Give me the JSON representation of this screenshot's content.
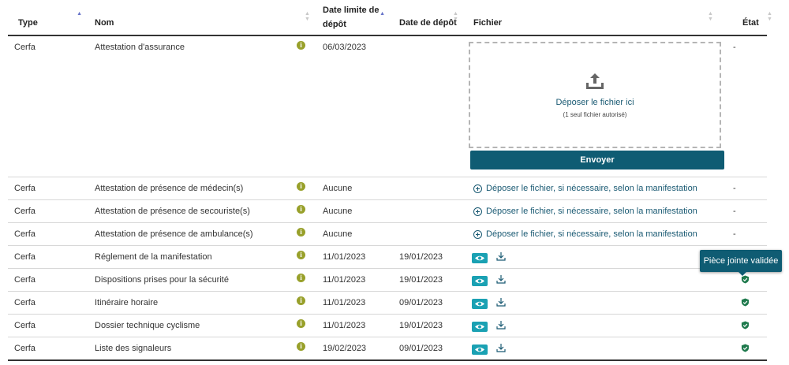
{
  "headers": {
    "type": "Type",
    "nom": "Nom",
    "date_limite": "Date limite de dépôt",
    "date_depot": "Date de dépôt",
    "fichier": "Fichier",
    "etat": "État"
  },
  "dropzone": {
    "title": "Déposer le fichier ici",
    "subtitle": "(1 seul fichier autorisé)",
    "send_label": "Envoyer"
  },
  "upload_link_label": "Déposer le fichier, si nécessaire, selon la manifestation",
  "tooltip": "Pièce jointe validée",
  "rows": [
    {
      "type": "Cerfa",
      "nom": "Attestation d'assurance",
      "date_limite": "06/03/2023",
      "date_depot": "",
      "etat": "-"
    },
    {
      "type": "Cerfa",
      "nom": "Attestation de présence de médecin(s)",
      "date_limite": "Aucune",
      "date_depot": "",
      "etat": "-"
    },
    {
      "type": "Cerfa",
      "nom": "Attestation de présence de secouriste(s)",
      "date_limite": "Aucune",
      "date_depot": "",
      "etat": "-"
    },
    {
      "type": "Cerfa",
      "nom": "Attestation de présence de ambulance(s)",
      "date_limite": "Aucune",
      "date_depot": "",
      "etat": "-"
    },
    {
      "type": "Cerfa",
      "nom": "Réglement de la manifestation",
      "date_limite": "11/01/2023",
      "date_depot": "19/01/2023",
      "etat": ""
    },
    {
      "type": "Cerfa",
      "nom": "Dispositions prises pour la sécurité",
      "date_limite": "11/01/2023",
      "date_depot": "19/01/2023",
      "etat": ""
    },
    {
      "type": "Cerfa",
      "nom": "Itinéraire horaire",
      "date_limite": "11/01/2023",
      "date_depot": "09/01/2023",
      "etat": ""
    },
    {
      "type": "Cerfa",
      "nom": "Dossier technique cyclisme",
      "date_limite": "11/01/2023",
      "date_depot": "19/01/2023",
      "etat": ""
    },
    {
      "type": "Cerfa",
      "nom": "Liste des signaleurs",
      "date_limite": "19/02/2023",
      "date_depot": "09/01/2023",
      "etat": ""
    }
  ],
  "icons": {
    "info": "info-icon",
    "upload": "upload-icon",
    "plus": "plus-circle-icon",
    "eye": "eye-icon",
    "download": "download-icon",
    "validated": "shield-check-icon"
  },
  "colors": {
    "primary": "#0f5c73",
    "link": "#1a5a73",
    "view_button": "#1aa1b3",
    "validated": "#1f7a4d",
    "info": "#98a02a"
  }
}
